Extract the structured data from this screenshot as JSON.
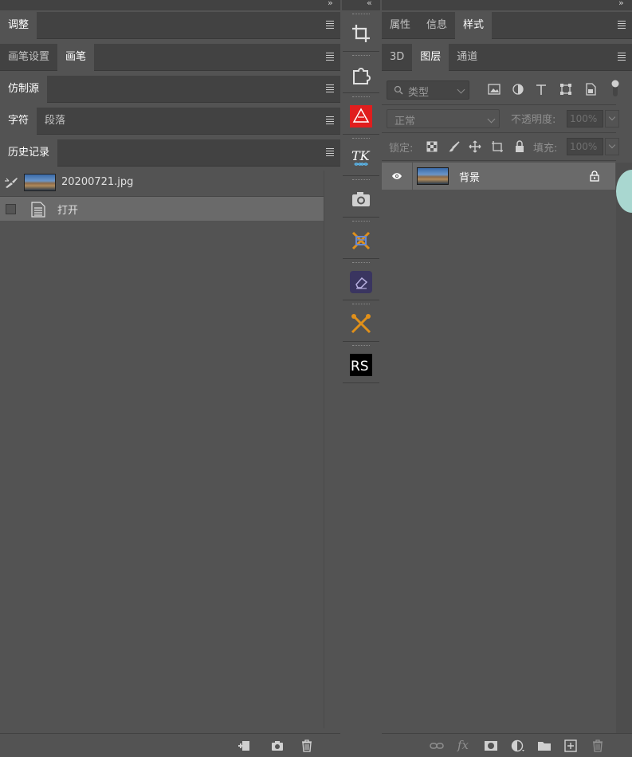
{
  "left_panel": {
    "collapse_glyph": "››",
    "groups": [
      {
        "tabs": [
          {
            "label": "调整",
            "active": true
          }
        ]
      },
      {
        "tabs": [
          {
            "label": "画笔设置",
            "active": false
          },
          {
            "label": "画笔",
            "active": true
          }
        ]
      },
      {
        "tabs": [
          {
            "label": "仿制源",
            "active": true
          }
        ]
      },
      {
        "tabs": [
          {
            "label": "字符",
            "active": true
          },
          {
            "label": "段落",
            "active": false
          }
        ]
      },
      {
        "tabs": [
          {
            "label": "历史记录",
            "active": true
          }
        ]
      }
    ],
    "history": {
      "snapshot_name": "20200721.jpg",
      "steps": [
        {
          "label": "打开",
          "selected": true
        }
      ]
    },
    "bottom_icons": [
      "new-document-from-state-icon",
      "camera-icon",
      "trash-icon"
    ]
  },
  "middle_strip": {
    "collapse_glyph": "‹‹",
    "tools": [
      {
        "icon": "crop-icon"
      },
      {
        "icon": "puzzle-plugin-icon"
      },
      {
        "icon": "red-mountain-plugin-icon",
        "color": "#e01e1e"
      },
      {
        "icon": "tk-plugin-icon",
        "text": "TK"
      },
      {
        "icon": "camera-icon"
      },
      {
        "icon": "crossed-brushes-plugin-icon"
      },
      {
        "icon": "eraser-plugin-icon",
        "color": "#3a3560"
      },
      {
        "icon": "crossed-tools-plugin-icon",
        "color": "#e0901a"
      },
      {
        "icon": "rs-plugin-icon",
        "text": "RS"
      }
    ]
  },
  "right_panel": {
    "collapse_glyph": "››",
    "groups": [
      {
        "tabs": [
          {
            "label": "属性",
            "active": false
          },
          {
            "label": "信息",
            "active": false
          },
          {
            "label": "样式",
            "active": true
          }
        ]
      },
      {
        "tabs": [
          {
            "label": "3D",
            "active": false
          },
          {
            "label": "图层",
            "active": true
          },
          {
            "label": "通道",
            "active": false
          }
        ]
      }
    ],
    "layers": {
      "filter_kind": "类型",
      "filter_icons": [
        "image-filter-icon",
        "adjustment-filter-icon",
        "type-filter-icon",
        "shape-filter-icon",
        "smart-object-filter-icon"
      ],
      "blend_mode": "正常",
      "opacity_label": "不透明度:",
      "opacity_value": "100%",
      "lock_label": "锁定:",
      "lock_icons": [
        "lock-transparent-pixels-icon",
        "lock-image-pixels-icon",
        "lock-position-icon",
        "lock-artboard-icon",
        "lock-all-icon"
      ],
      "fill_label": "填充:",
      "fill_value": "100%",
      "items": [
        {
          "name": "背景",
          "visible": true,
          "locked": true
        }
      ],
      "bottom_icons": [
        "link-layers-icon",
        "fx-icon",
        "add-mask-icon",
        "new-adjustment-layer-icon",
        "new-group-icon",
        "new-layer-icon",
        "delete-layer-icon"
      ],
      "fx_text": "fx"
    }
  }
}
